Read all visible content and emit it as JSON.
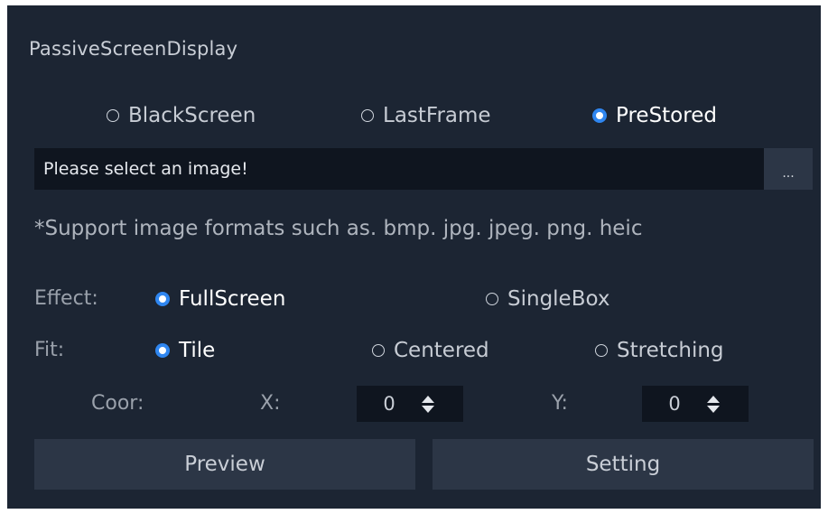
{
  "title": "PassiveScreenDisplay",
  "source_options": {
    "black_screen": "BlackScreen",
    "last_frame": "LastFrame",
    "pre_stored": "PreStored",
    "selected": "PreStored"
  },
  "image_path": {
    "placeholder": "Please select an image!",
    "browse_label": "..."
  },
  "note": "*Support image formats such as. bmp. jpg. jpeg. png. heic",
  "effect": {
    "label": "Effect:",
    "full_screen": "FullScreen",
    "single_box": "SingleBox",
    "selected": "FullScreen"
  },
  "fit": {
    "label": "Fit:",
    "tile": "Tile",
    "centered": "Centered",
    "stretching": "Stretching",
    "selected": "Tile"
  },
  "coor": {
    "label": "Coor:",
    "x_label": "X:",
    "x_value": "0",
    "y_label": "Y:",
    "y_value": "0"
  },
  "buttons": {
    "preview": "Preview",
    "setting": "Setting"
  },
  "colors": {
    "panel_bg": "#1c2533",
    "input_bg": "#0f151f",
    "button_bg": "#2c3646",
    "accent": "#2f86f0"
  }
}
